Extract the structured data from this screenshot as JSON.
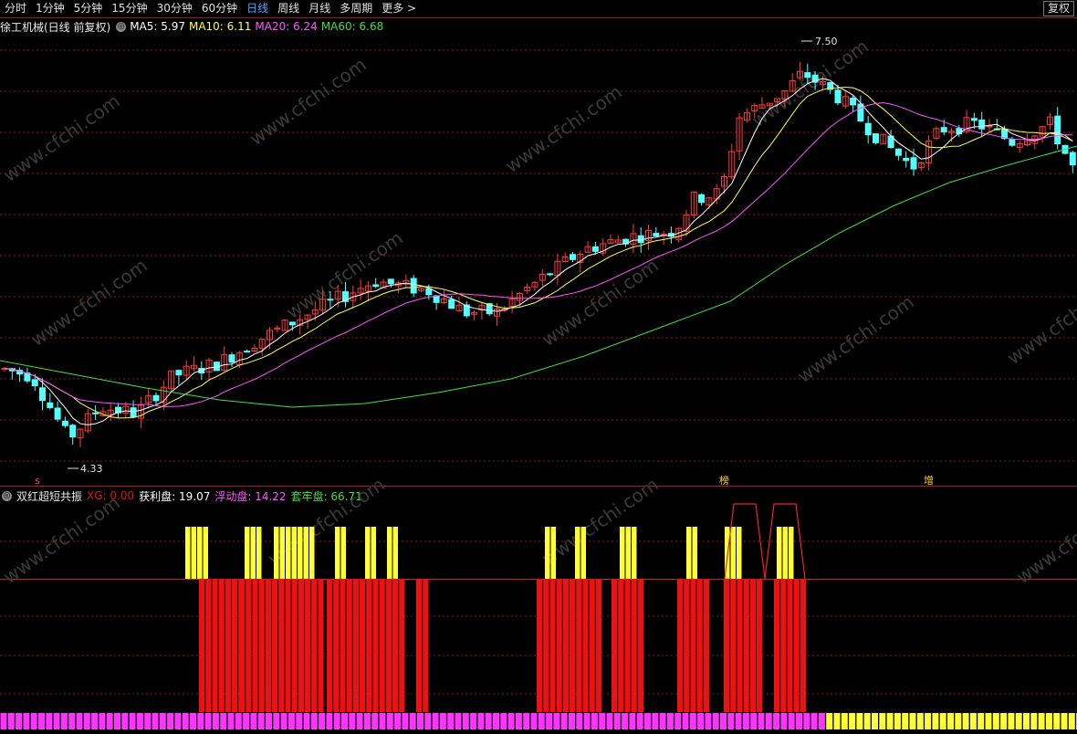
{
  "toolbar": {
    "periods": [
      "分时",
      "1分钟",
      "5分钟",
      "15分钟",
      "30分钟",
      "60分钟",
      "日线",
      "周线",
      "月线",
      "多周期",
      "更多 >"
    ],
    "active_period": "日线",
    "fq_label": "复权"
  },
  "main_panel": {
    "title": "徐工机械(日线 前复权)",
    "ma5": "MA5: 5.97",
    "ma10": "MA10: 6.11",
    "ma20": "MA20: 6.24",
    "ma60": "MA60: 6.68",
    "high_label": "7.50",
    "low_label": "4.33",
    "markers": [
      "s",
      "榜",
      "增"
    ]
  },
  "indicator_panel": {
    "title": "双红超短共振",
    "xg": "XG: 0.00",
    "profit": "获利盘: 19.07",
    "float": "浮动盘: 14.22",
    "locked": "套牢盘: 66.71"
  },
  "watermark": "www.cfchi.com",
  "colors": {
    "up": "#ff3a3a",
    "down": "#54ffff",
    "ma5": "#ffffff",
    "ma10": "#ffff55",
    "ma20": "#ff55ff",
    "ma60": "#44dd44",
    "grid": "#8a1a1a",
    "yellow_bar": "#ffff33",
    "red_bar": "#ee1111",
    "magenta_bar": "#ff33ff"
  }
}
